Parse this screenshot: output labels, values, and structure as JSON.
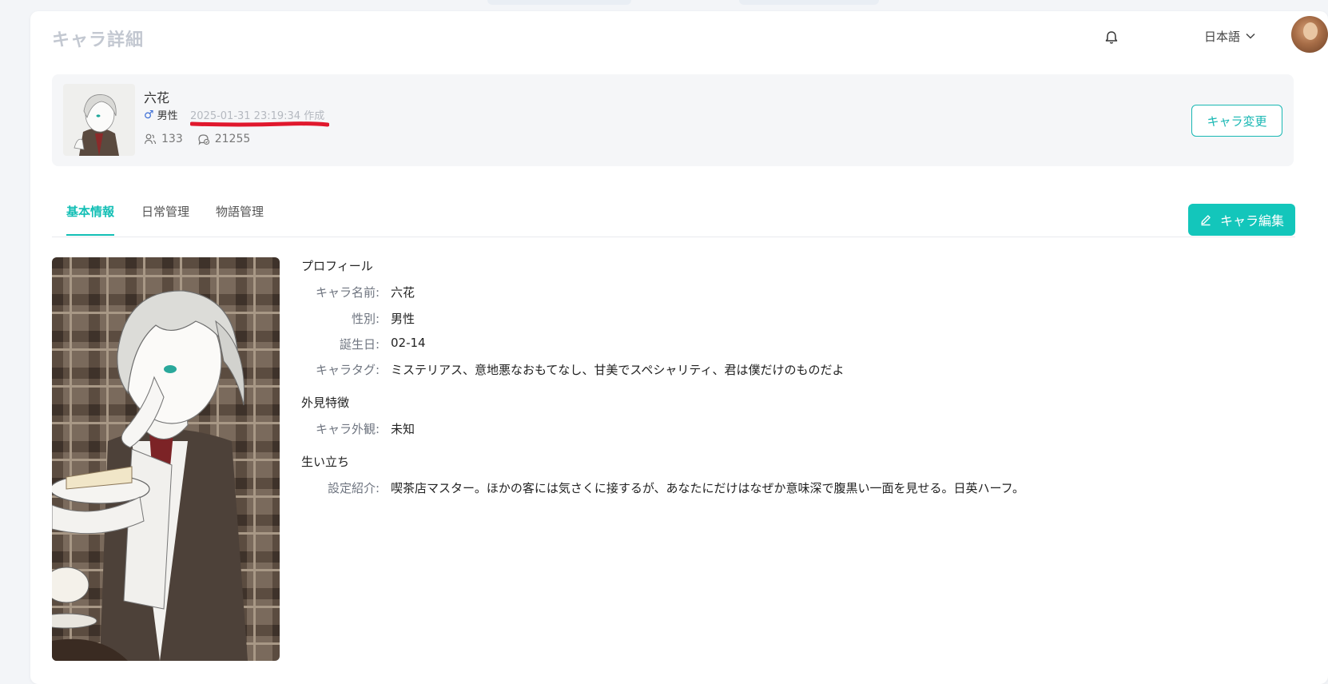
{
  "header": {
    "title": "キャラ詳細",
    "language": "日本語"
  },
  "character": {
    "name": "六花",
    "gender": "男性",
    "created": "2025-01-31 23:19:34 作成",
    "followers": "133",
    "chats": "21255",
    "change_button": "キャラ変更"
  },
  "tabs": [
    "基本情報",
    "日常管理",
    "物語管理"
  ],
  "edit_button": "キャラ編集",
  "profile": {
    "section_title": "プロフィール",
    "name_label": "キャラ名前:",
    "name_value": "六花",
    "gender_label": "性別:",
    "gender_value": "男性",
    "birthday_label": "誕生日:",
    "birthday_value": "02-14",
    "tags_label": "キャラタグ:",
    "tags_value": "ミステリアス、意地悪なおもてなし、甘美でスペシャリティ、君は僕だけのものだよ"
  },
  "appearance": {
    "section_title": "外見特徴",
    "label": "キャラ外観:",
    "value": "未知"
  },
  "background": {
    "section_title": "生い立ち",
    "label": "設定紹介:",
    "value": "喫茶店マスター。ほかの客には気さくに接するが、あなたにだけはなぜか意味深で腹黒い一面を見せる。日英ハーフ。"
  },
  "colors": {
    "accent": "#13c6bb",
    "highlight_mark": "#e0182d"
  }
}
